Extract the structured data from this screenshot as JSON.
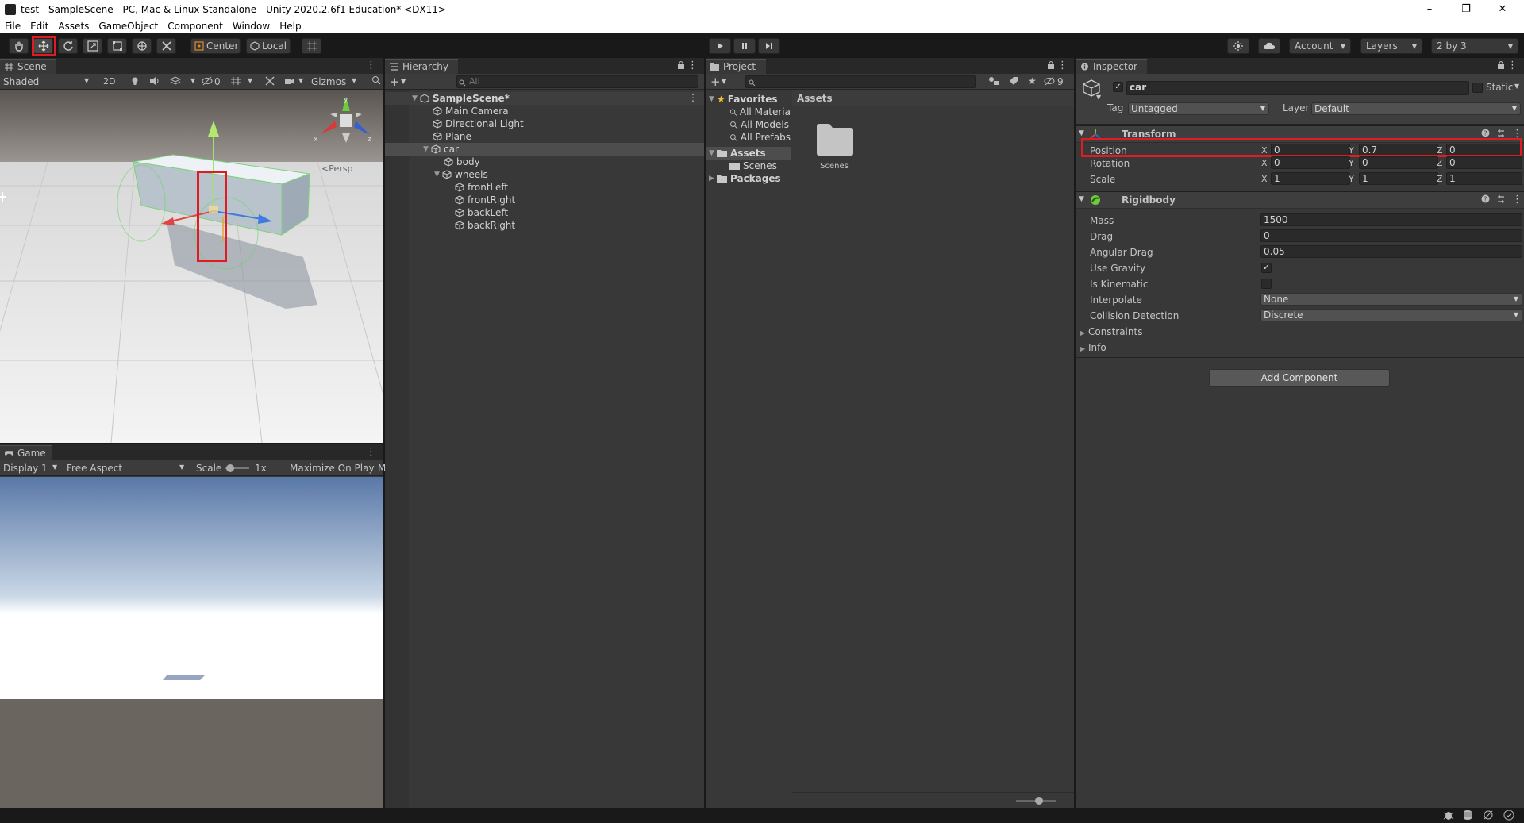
{
  "window": {
    "title": "test - SampleScene - PC, Mac & Linux Standalone - Unity 2020.2.6f1 Education* <DX11>",
    "controls": {
      "minimize": "–",
      "maximize": "❐",
      "close": "✕"
    }
  },
  "menu": [
    "File",
    "Edit",
    "Assets",
    "GameObject",
    "Component",
    "Window",
    "Help"
  ],
  "toolbar": {
    "tools": [
      "hand",
      "move",
      "rotate",
      "scale",
      "rect",
      "transform",
      "custom"
    ],
    "selected_tool": "move",
    "pivot_label": "Center",
    "space_label": "Local",
    "account_label": "Account",
    "layers_label": "Layers",
    "layout_label": "2 by 3"
  },
  "scene": {
    "tab_label": "Scene",
    "shading": "Shaded",
    "mode_2d": "2D",
    "hidden_count": "0",
    "gizmos_label": "Gizmos",
    "persp_label": "Persp",
    "axis_labels": {
      "x": "x",
      "y": "y",
      "z": "z"
    }
  },
  "game": {
    "tab_label": "Game",
    "display": "Display 1",
    "aspect": "Free Aspect",
    "scale_label": "Scale",
    "scale_value": "1x",
    "maximize_label": "Maximize On Play",
    "overflow_label": "M"
  },
  "hierarchy": {
    "tab_label": "Hierarchy",
    "search_placeholder": "All",
    "scene_name": "SampleScene*",
    "items": [
      {
        "label": "Main Camera"
      },
      {
        "label": "Directional Light"
      },
      {
        "label": "Plane"
      },
      {
        "label": "car"
      },
      {
        "label": "body"
      },
      {
        "label": "wheels"
      },
      {
        "label": "frontLeft"
      },
      {
        "label": "frontRight"
      },
      {
        "label": "backLeft"
      },
      {
        "label": "backRight"
      }
    ]
  },
  "project": {
    "tab_label": "Project",
    "hidden_count": "9",
    "favorites_label": "Favorites",
    "favorites": [
      "All Materia",
      "All Models",
      "All Prefabs"
    ],
    "assets_label": "Assets",
    "scenes_label": "Scenes",
    "packages_label": "Packages",
    "breadcrumb": "Assets",
    "folder_label": "Scenes"
  },
  "inspector": {
    "tab_label": "Inspector",
    "object_name": "car",
    "static_label": "Static",
    "tag_label": "Tag",
    "tag_value": "Untagged",
    "layer_label": "Layer",
    "layer_value": "Default",
    "transform": {
      "title": "Transform",
      "position_label": "Position",
      "rotation_label": "Rotation",
      "scale_label": "Scale",
      "axis_x": "X",
      "axis_y": "Y",
      "axis_z": "Z",
      "position": {
        "x": "0",
        "y": "0.7",
        "z": "0"
      },
      "rotation": {
        "x": "0",
        "y": "0",
        "z": "0"
      },
      "scale": {
        "x": "1",
        "y": "1",
        "z": "1"
      }
    },
    "rigidbody": {
      "title": "Rigidbody",
      "mass_label": "Mass",
      "mass": "1500",
      "drag_label": "Drag",
      "drag": "0",
      "angular_drag_label": "Angular Drag",
      "angular_drag": "0.05",
      "use_gravity_label": "Use Gravity",
      "use_gravity": true,
      "is_kinematic_label": "Is Kinematic",
      "is_kinematic": false,
      "interpolate_label": "Interpolate",
      "interpolate": "None",
      "collision_label": "Collision Detection",
      "collision": "Discrete",
      "constraints_label": "Constraints",
      "info_label": "Info"
    },
    "add_component_label": "Add Component"
  },
  "colors": {
    "accent_red": "#e11b22",
    "panel_bg": "#383838",
    "sky_top": "#5a78a8",
    "ground": "#6b6560"
  }
}
